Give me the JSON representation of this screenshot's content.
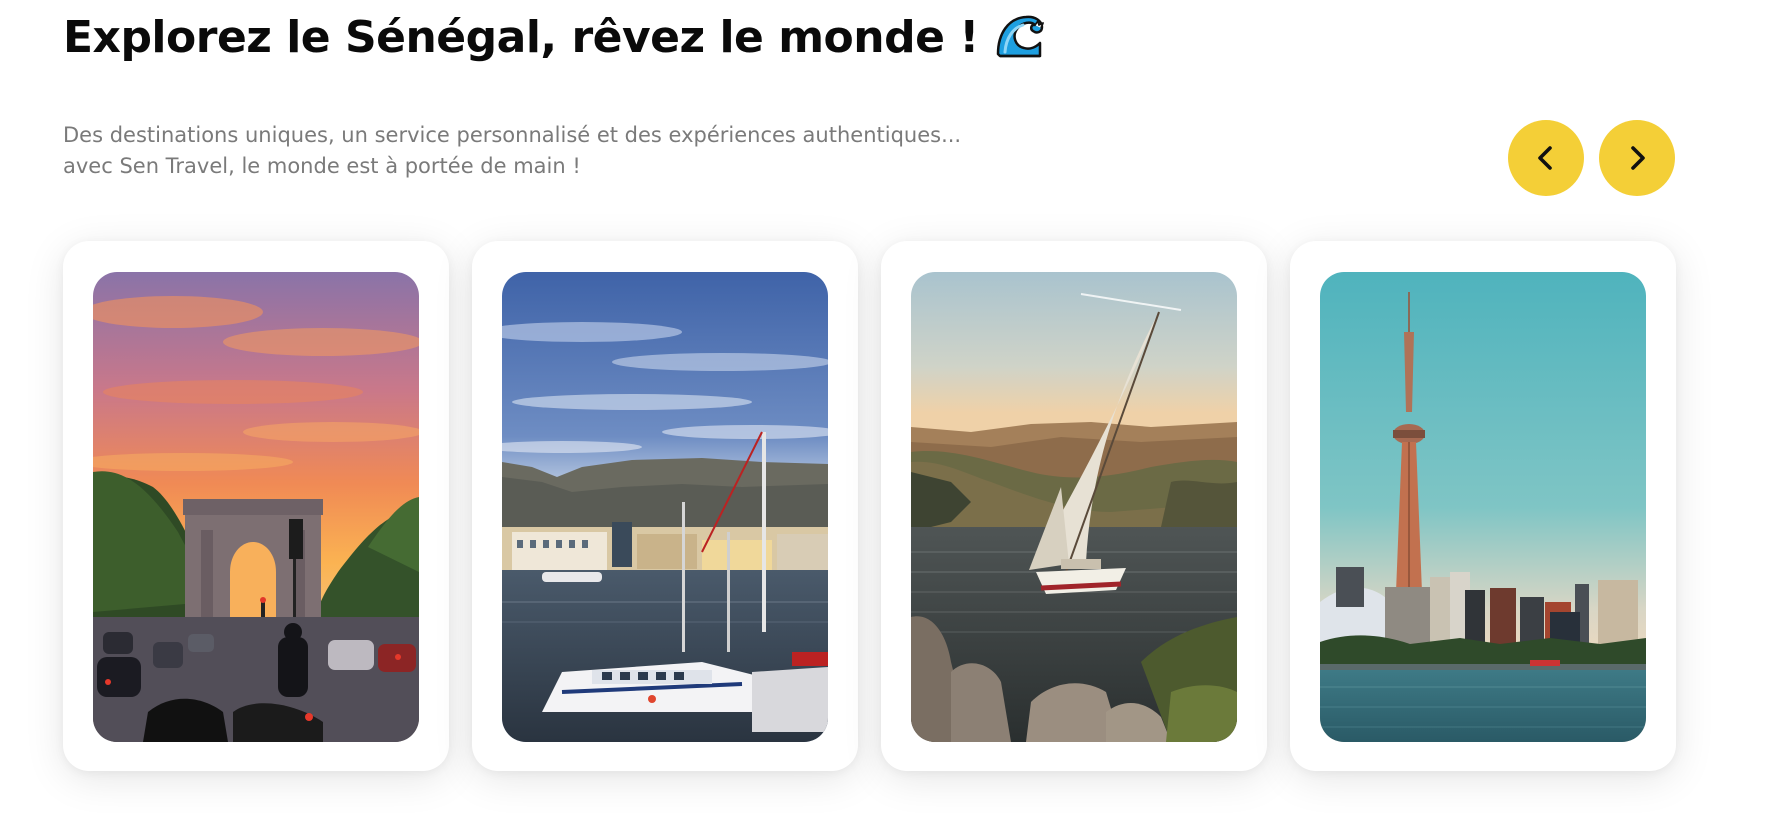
{
  "header": {
    "title": "Explorez le Sénégal, rêvez le monde !",
    "title_emoji_icon": "water-wave-icon",
    "subtitle_line1": "Des destinations uniques, un service personnalisé et des expériences authentiques...",
    "subtitle_line2": "avec Sen Travel, le monde est à portée de main !"
  },
  "carousel": {
    "prev_icon": "chevron-left-icon",
    "next_icon": "chevron-right-icon",
    "cards": [
      {
        "image": "arc-de-triomphe-sunset-photo"
      },
      {
        "image": "cape-town-harbour-table-mountain-photo"
      },
      {
        "image": "nile-felucca-sailboat-photo"
      },
      {
        "image": "toronto-cn-tower-skyline-photo"
      }
    ]
  },
  "colors": {
    "accent": "#f4cf37",
    "title": "#0a0a0a",
    "subtitle": "#7a7a7a",
    "background": "#ffffff"
  }
}
